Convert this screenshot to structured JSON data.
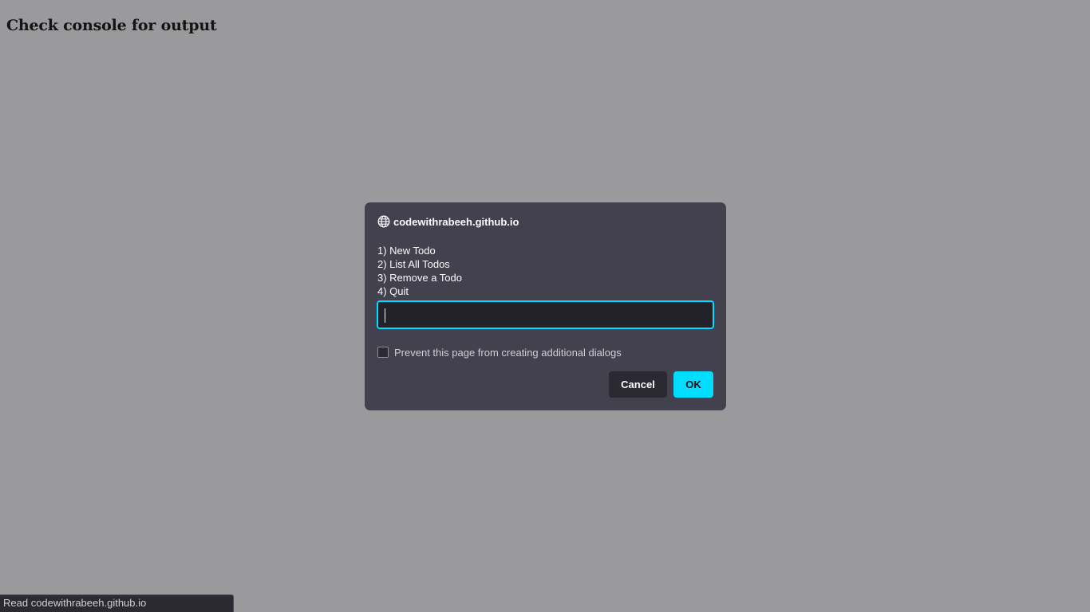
{
  "page": {
    "heading": "Check console for output"
  },
  "dialog": {
    "origin": "codewithrabeeh.github.io",
    "origin_icon": "globe-icon",
    "message_lines": [
      "1) New Todo",
      "2) List All Todos",
      "3) Remove a Todo",
      "4) Quit"
    ],
    "input_value": "",
    "checkbox_label": "Prevent this page from creating additional dialogs",
    "checkbox_checked": false,
    "cancel_label": "Cancel",
    "ok_label": "OK"
  },
  "status_bar": {
    "text": "Read codewithrabeeh.github.io"
  },
  "colors": {
    "backdrop": "#9a9a9c",
    "dialog_bg": "#42414d",
    "accent": "#00ddff",
    "input_bg": "#23222b",
    "cancel_bg": "#2b2a33"
  }
}
